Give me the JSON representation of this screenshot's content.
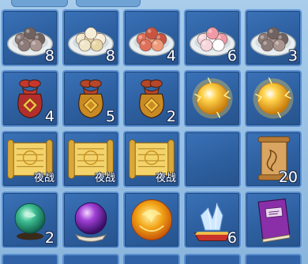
{
  "inventory": {
    "slots": [
      {
        "row": 0,
        "col": 0,
        "item": "grey-dumplings-plate-icon",
        "count": "8",
        "tag": ""
      },
      {
        "row": 0,
        "col": 1,
        "item": "rice-balls-plate-icon",
        "count": "8",
        "tag": ""
      },
      {
        "row": 0,
        "col": 2,
        "item": "red-dumplings-plate-icon",
        "count": "4",
        "tag": ""
      },
      {
        "row": 0,
        "col": 3,
        "item": "flower-cakes-plate-icon",
        "count": "6",
        "tag": ""
      },
      {
        "row": 0,
        "col": 4,
        "item": "grey-dumplings-plate-icon",
        "count": "3",
        "tag": ""
      },
      {
        "row": 1,
        "col": 0,
        "item": "red-lucky-bag-icon",
        "count": "4",
        "tag": ""
      },
      {
        "row": 1,
        "col": 1,
        "item": "gold-lucky-bag-icon",
        "count": "5",
        "tag": ""
      },
      {
        "row": 1,
        "col": 2,
        "item": "gold-lucky-bag-icon",
        "count": "2",
        "tag": ""
      },
      {
        "row": 1,
        "col": 3,
        "item": "golden-orb-icon",
        "count": "",
        "tag": ""
      },
      {
        "row": 1,
        "col": 4,
        "item": "golden-orb-icon",
        "count": "",
        "tag": ""
      },
      {
        "row": 2,
        "col": 0,
        "item": "golden-scroll-icon",
        "count": "",
        "tag": "夜战"
      },
      {
        "row": 2,
        "col": 1,
        "item": "golden-scroll-icon",
        "count": "",
        "tag": "夜战"
      },
      {
        "row": 2,
        "col": 2,
        "item": "golden-scroll-icon",
        "count": "",
        "tag": "夜战"
      },
      {
        "row": 2,
        "col": 3,
        "item": "",
        "count": "",
        "tag": ""
      },
      {
        "row": 2,
        "col": 4,
        "item": "parchment-scroll-icon",
        "count": "20",
        "tag": ""
      },
      {
        "row": 3,
        "col": 0,
        "item": "jade-orb-icon",
        "count": "2",
        "tag": ""
      },
      {
        "row": 3,
        "col": 1,
        "item": "purple-orb-icon",
        "count": "",
        "tag": ""
      },
      {
        "row": 3,
        "col": 2,
        "item": "fire-orb-icon",
        "count": "",
        "tag": ""
      },
      {
        "row": 3,
        "col": 3,
        "item": "crystal-cushion-icon",
        "count": "6",
        "tag": ""
      },
      {
        "row": 3,
        "col": 4,
        "item": "purple-book-icon",
        "count": "",
        "tag": ""
      }
    ]
  },
  "colors": {
    "slot_bg": "#2d5f9f",
    "slot_border": "#5a8fd0",
    "frame": "#8fb9df"
  }
}
